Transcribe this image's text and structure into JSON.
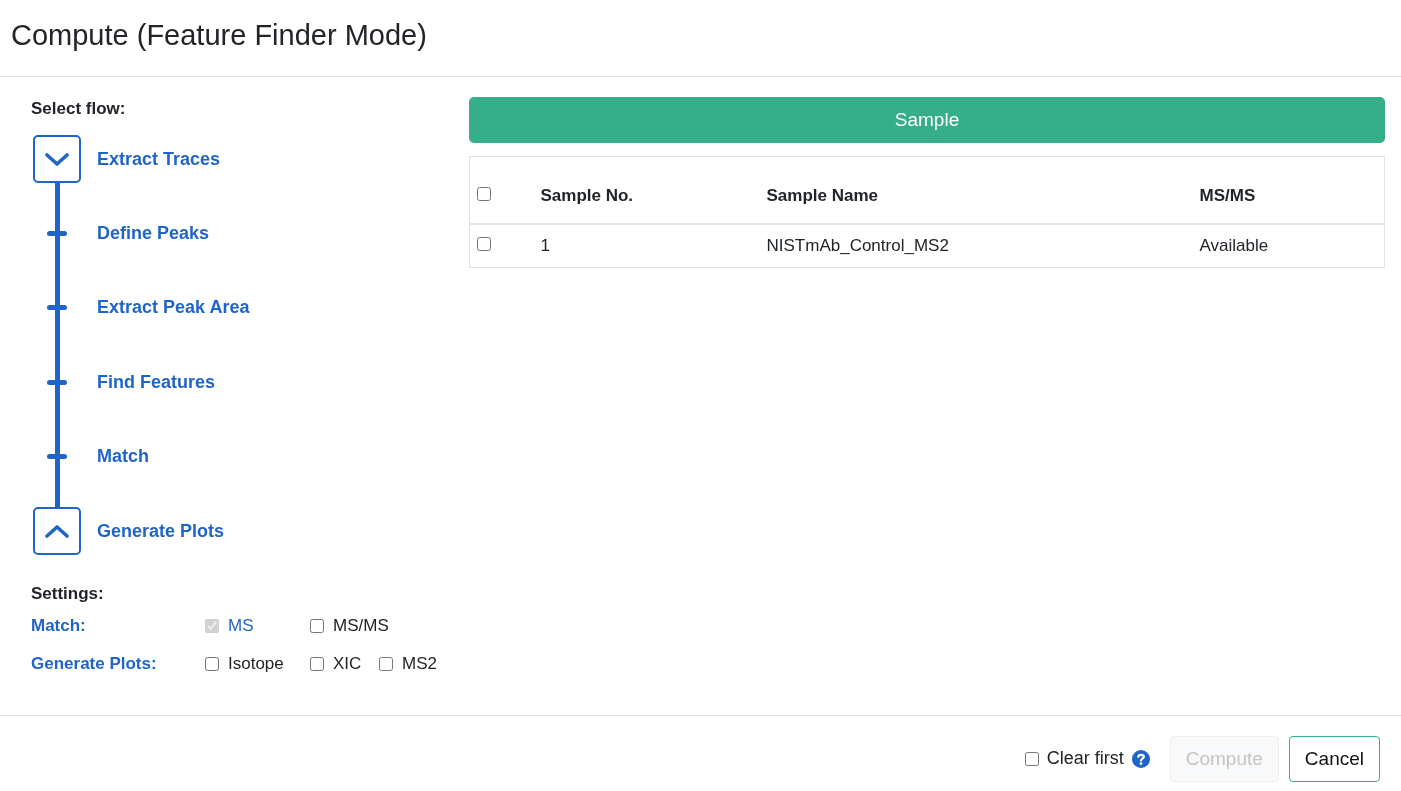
{
  "dialog": {
    "title": "Compute (Feature Finder Mode)"
  },
  "flow": {
    "label": "Select flow:",
    "steps": [
      {
        "label": "Extract Traces",
        "kind": "start"
      },
      {
        "label": "Define Peaks",
        "kind": "step"
      },
      {
        "label": "Extract Peak Area",
        "kind": "step"
      },
      {
        "label": "Find Features",
        "kind": "step"
      },
      {
        "label": "Match",
        "kind": "step"
      },
      {
        "label": "Generate Plots",
        "kind": "end"
      }
    ]
  },
  "settings": {
    "label": "Settings:",
    "rows": [
      {
        "label": "Match:",
        "options": [
          {
            "label": "MS",
            "checked": true,
            "disabled": true
          },
          {
            "label": "MS/MS",
            "checked": false,
            "disabled": false
          }
        ]
      },
      {
        "label": "Generate Plots:",
        "options": [
          {
            "label": "Isotope",
            "checked": false,
            "disabled": false
          },
          {
            "label": "XIC",
            "checked": false,
            "disabled": false
          },
          {
            "label": "MS2",
            "checked": false,
            "disabled": false
          }
        ]
      }
    ]
  },
  "sample_panel": {
    "header": "Sample",
    "table": {
      "select_all": {
        "checked": false
      },
      "columns": [
        "Sample No.",
        "Sample Name",
        "MS/MS"
      ],
      "rows": [
        {
          "selected": false,
          "cells": [
            "1",
            "NISTmAb_Control_MS2",
            "Available"
          ]
        }
      ]
    }
  },
  "footer": {
    "clear_first": {
      "label": "Clear first",
      "checked": false
    },
    "buttons": [
      {
        "label": "Compute",
        "kind": "primary",
        "disabled": true
      },
      {
        "label": "Cancel",
        "kind": "outline",
        "disabled": false
      }
    ]
  }
}
